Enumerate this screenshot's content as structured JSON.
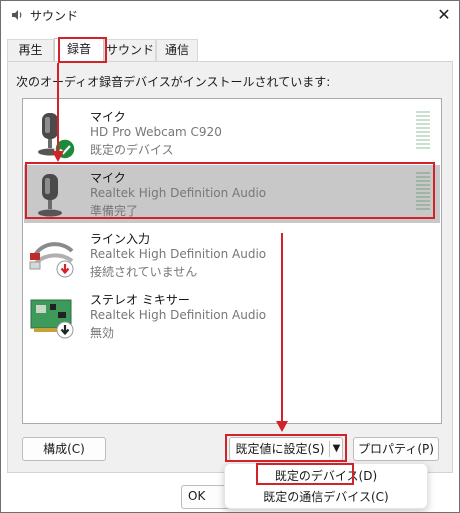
{
  "window": {
    "title": "サウンド",
    "tabs": [
      {
        "label": "再生"
      },
      {
        "label": "録音"
      },
      {
        "label": "サウンド"
      },
      {
        "label": "通信"
      }
    ]
  },
  "panel": {
    "intro": "次のオーディオ録音デバイスがインストールされています:"
  },
  "devices": [
    {
      "name": "マイク",
      "line1": "HD Pro Webcam C920",
      "line2": "既定のデバイス",
      "status_icon": "check-icon",
      "icon": "microphone-icon"
    },
    {
      "name": "マイク",
      "line1": "Realtek High Definition Audio",
      "line2": "準備完了",
      "icon": "microphone-icon"
    },
    {
      "name": "ライン入力",
      "line1": "Realtek High Definition Audio",
      "line2": "接続されていません",
      "status_icon": "down-arrow-red-icon",
      "icon": "cable-icon"
    },
    {
      "name": "ステレオ ミキサー",
      "line1": "Realtek High Definition Audio",
      "line2": "無効",
      "status_icon": "down-arrow-black-icon",
      "icon": "circuit-board-icon"
    }
  ],
  "buttons": {
    "configure": "構成(C)",
    "set_default": "既定値に設定(S)",
    "properties": "プロパティ(P)",
    "ok": "OK"
  },
  "dropdown_menu": {
    "items": [
      "既定のデバイス(D)",
      "既定の通信デバイス(C)"
    ]
  },
  "colors": {
    "annotation_red": "#d2232a",
    "selection_gray": "#c8c8c8",
    "check_green": "#1b8a3a"
  }
}
